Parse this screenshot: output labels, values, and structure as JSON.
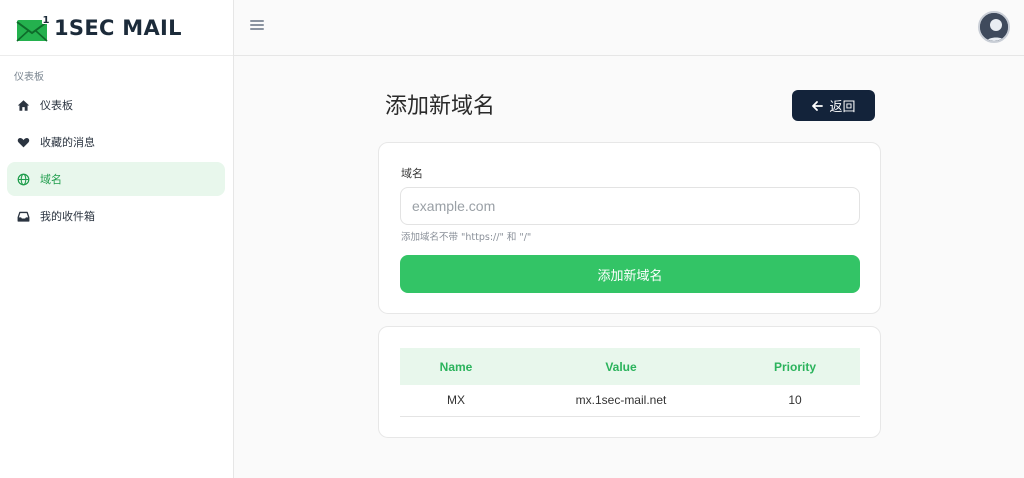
{
  "brand": {
    "name": "1SEC MAIL"
  },
  "sidebar": {
    "section_label": "仪表板",
    "items": [
      {
        "label": "仪表板",
        "icon": "home-icon",
        "active": false
      },
      {
        "label": "收藏的消息",
        "icon": "heart-icon",
        "active": false
      },
      {
        "label": "域名",
        "icon": "globe-icon",
        "active": true
      },
      {
        "label": "我的收件箱",
        "icon": "inbox-icon",
        "active": false
      }
    ]
  },
  "page": {
    "title": "添加新域名",
    "back_label": "返回"
  },
  "form": {
    "domain_label": "域名",
    "domain_placeholder": "example.com",
    "domain_value": "",
    "help_text": "添加域名不带 \"https://\" 和 \"/\"",
    "submit_label": "添加新域名"
  },
  "dns_table": {
    "headers": [
      "Name",
      "Value",
      "Priority"
    ],
    "rows": [
      {
        "name": "MX",
        "value": "mx.1sec-mail.net",
        "priority": "10"
      }
    ]
  },
  "colors": {
    "accent": "#33c466",
    "accent_light": "#e8f7ec",
    "dark_button": "#13233a"
  }
}
